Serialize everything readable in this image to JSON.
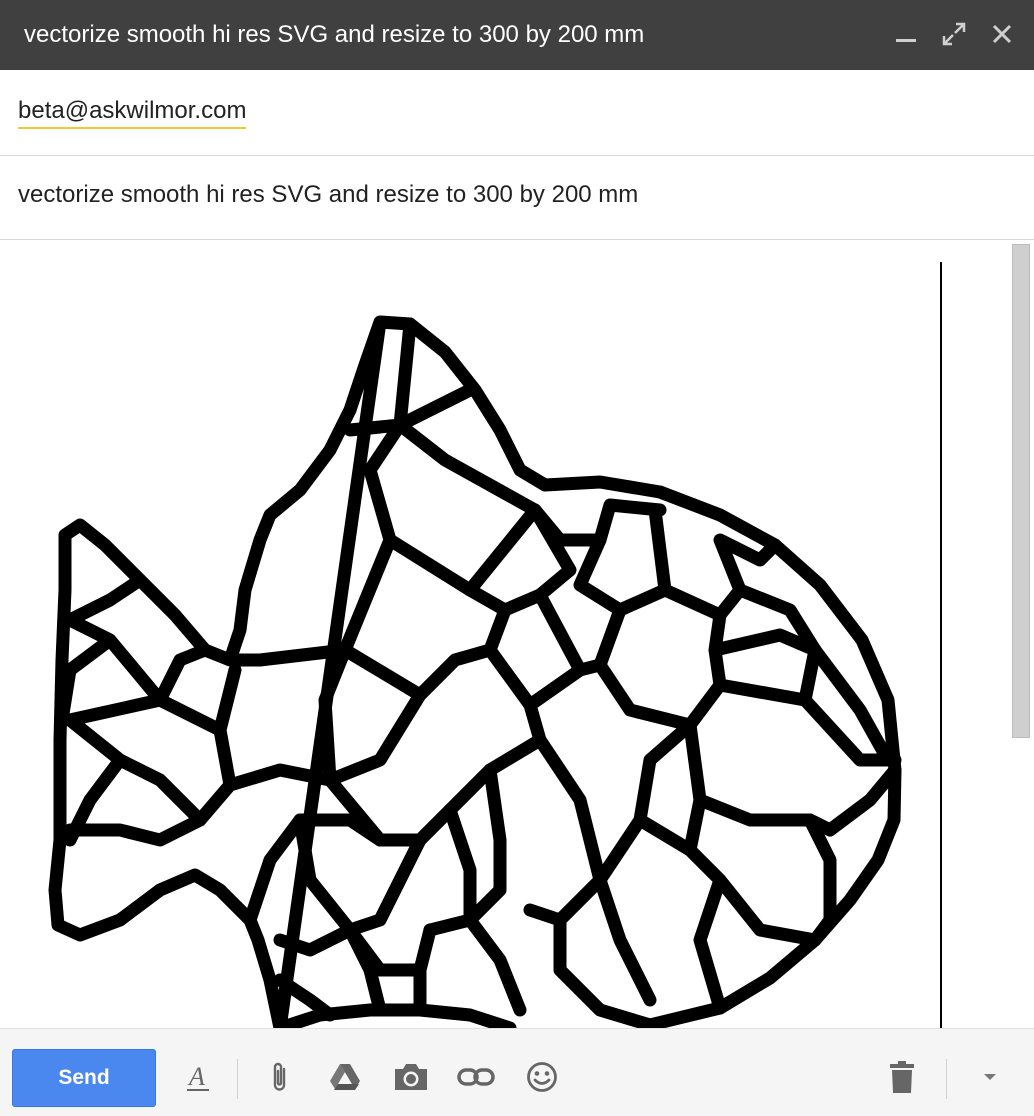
{
  "window": {
    "title": "vectorize smooth hi res SVG and resize to 300 by 200 mm",
    "controls": [
      "minimize-icon",
      "expand-icon",
      "close-icon"
    ]
  },
  "recipients": {
    "to": "beta@askwilmor.com"
  },
  "subject": "vectorize smooth hi res SVG and resize to 300 by 200 mm",
  "body": {
    "image_description_icon": "fish-voronoi-image"
  },
  "toolbar": {
    "send_label": "Send",
    "icons": [
      "format-text-icon",
      "attach-icon",
      "drive-icon",
      "camera-icon",
      "link-icon",
      "emoji-icon",
      "trash-icon",
      "more-options-icon"
    ]
  },
  "colors": {
    "titlebar": "#404040",
    "send_button": "#4a87ee",
    "recipient_underline": "#f5c92b"
  }
}
